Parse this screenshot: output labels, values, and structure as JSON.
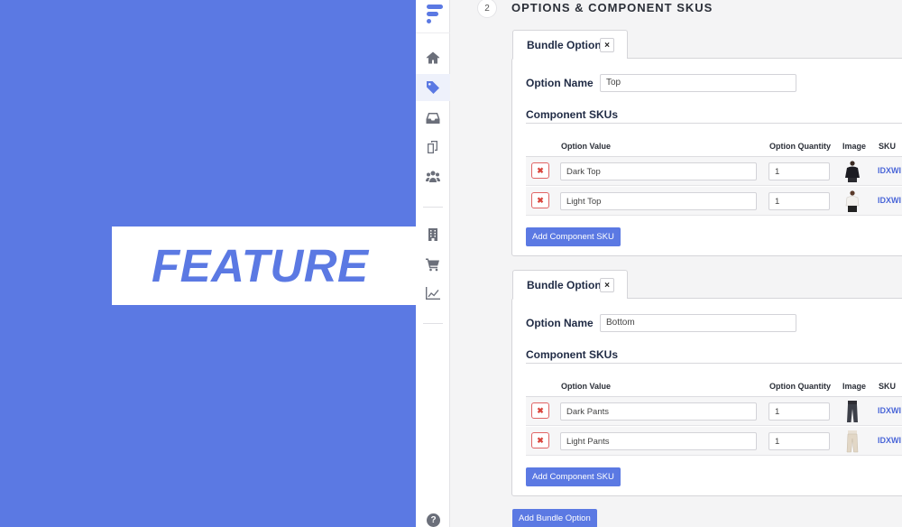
{
  "feature": {
    "label": "FEATURE"
  },
  "app": {
    "section": {
      "step": "2",
      "title": "OPTIONS & COMPONENT SKUS"
    },
    "sidebar": {
      "items": [
        {
          "icon": "home-icon"
        },
        {
          "icon": "tag-icon",
          "active": true
        },
        {
          "icon": "inbox-icon"
        },
        {
          "icon": "documents-icon"
        },
        {
          "icon": "users-icon"
        },
        {
          "icon": "building-icon"
        },
        {
          "icon": "cart-icon"
        },
        {
          "icon": "chart-icon"
        }
      ],
      "help_icon": "help-icon",
      "help_glyph": "?"
    },
    "bundles": [
      {
        "tab_label": "Bundle Option",
        "close_glyph": "×",
        "option_name_label": "Option Name",
        "option_name_value": "Top",
        "component_skus_label": "Component SKUs",
        "columns": {
          "value": "Option Value",
          "qty": "Option Quantity",
          "image": "Image",
          "sku": "SKU"
        },
        "rows": [
          {
            "value": "Dark Top",
            "qty": "1",
            "sku": "IDXWI",
            "image": "dark-top"
          },
          {
            "value": "Light Top",
            "qty": "1",
            "sku": "IDXWI",
            "image": "light-top"
          }
        ],
        "add_component_label": "Add Component SKU"
      },
      {
        "tab_label": "Bundle Option",
        "close_glyph": "×",
        "option_name_label": "Option Name",
        "option_name_value": "Bottom",
        "component_skus_label": "Component SKUs",
        "columns": {
          "value": "Option Value",
          "qty": "Option Quantity",
          "image": "Image",
          "sku": "SKU"
        },
        "rows": [
          {
            "value": "Dark Pants",
            "qty": "1",
            "sku": "IDXWI",
            "image": "dark-pants"
          },
          {
            "value": "Light Pants",
            "qty": "1",
            "sku": "IDXWI",
            "image": "light-pants"
          }
        ],
        "add_component_label": "Add Component SKU"
      }
    ],
    "delete_glyph": "✖",
    "add_bundle_label": "Add Bundle Option"
  },
  "colors": {
    "brand": "#5b79e3",
    "danger": "#d9463d",
    "link": "#4a66d8"
  }
}
